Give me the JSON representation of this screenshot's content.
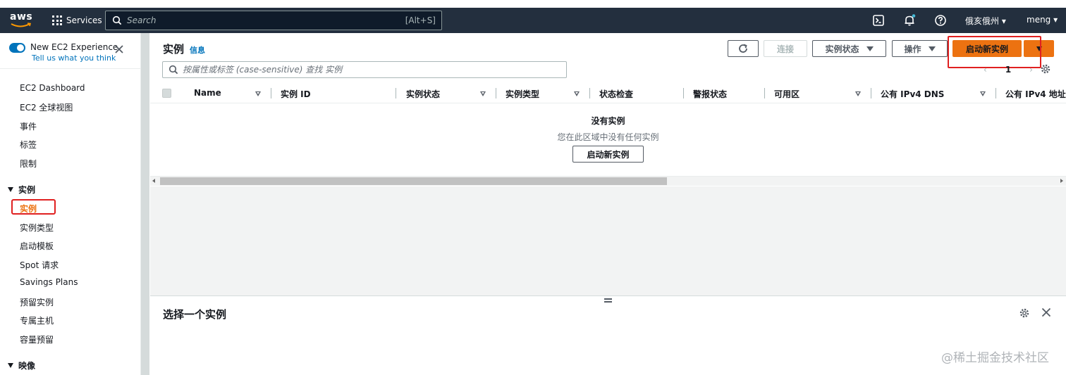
{
  "nav": {
    "logo_text": "aws",
    "services_label": "Services",
    "search_placeholder": "Search",
    "search_shortcut": "[Alt+S]",
    "region": "俄亥俄州 ▾",
    "user": "meng ▾"
  },
  "sidebar": {
    "new_experience_title": "New EC2 Experience",
    "new_experience_link": "Tell us what you think",
    "items_top": [
      "EC2 Dashboard",
      "EC2 全球视图",
      "事件",
      "标签",
      "限制"
    ],
    "section_instances": "实例",
    "instances_items": [
      "实例",
      "实例类型",
      "启动模板",
      "Spot 请求",
      "Savings Plans",
      "预留实例",
      "专属主机",
      "容量预留"
    ],
    "section_images": "映像"
  },
  "main": {
    "title": "实例",
    "info": "信息",
    "connect_label": "连接",
    "instance_state_label": "实例状态",
    "actions_label": "操作",
    "launch_label": "启动新实例",
    "filter_placeholder": "按属性或标签 (case-sensitive) 查找 实例",
    "page_number": "1",
    "columns": [
      "Name",
      "实例 ID",
      "实例状态",
      "实例类型",
      "状态检查",
      "警报状态",
      "可用区",
      "公有 IPv4 DNS",
      "公有 IPv4 地址"
    ],
    "empty_title": "没有实例",
    "empty_subtitle": "您在此区域中没有任何实例",
    "empty_button": "启动新实例",
    "detail_title": "选择一个实例"
  },
  "watermark": "@稀土掘金技术社区",
  "colors": {
    "nav_bg": "#232f3e",
    "accent_orange": "#ec7211",
    "link_blue": "#0073bb",
    "highlight_red": "#e02020"
  }
}
